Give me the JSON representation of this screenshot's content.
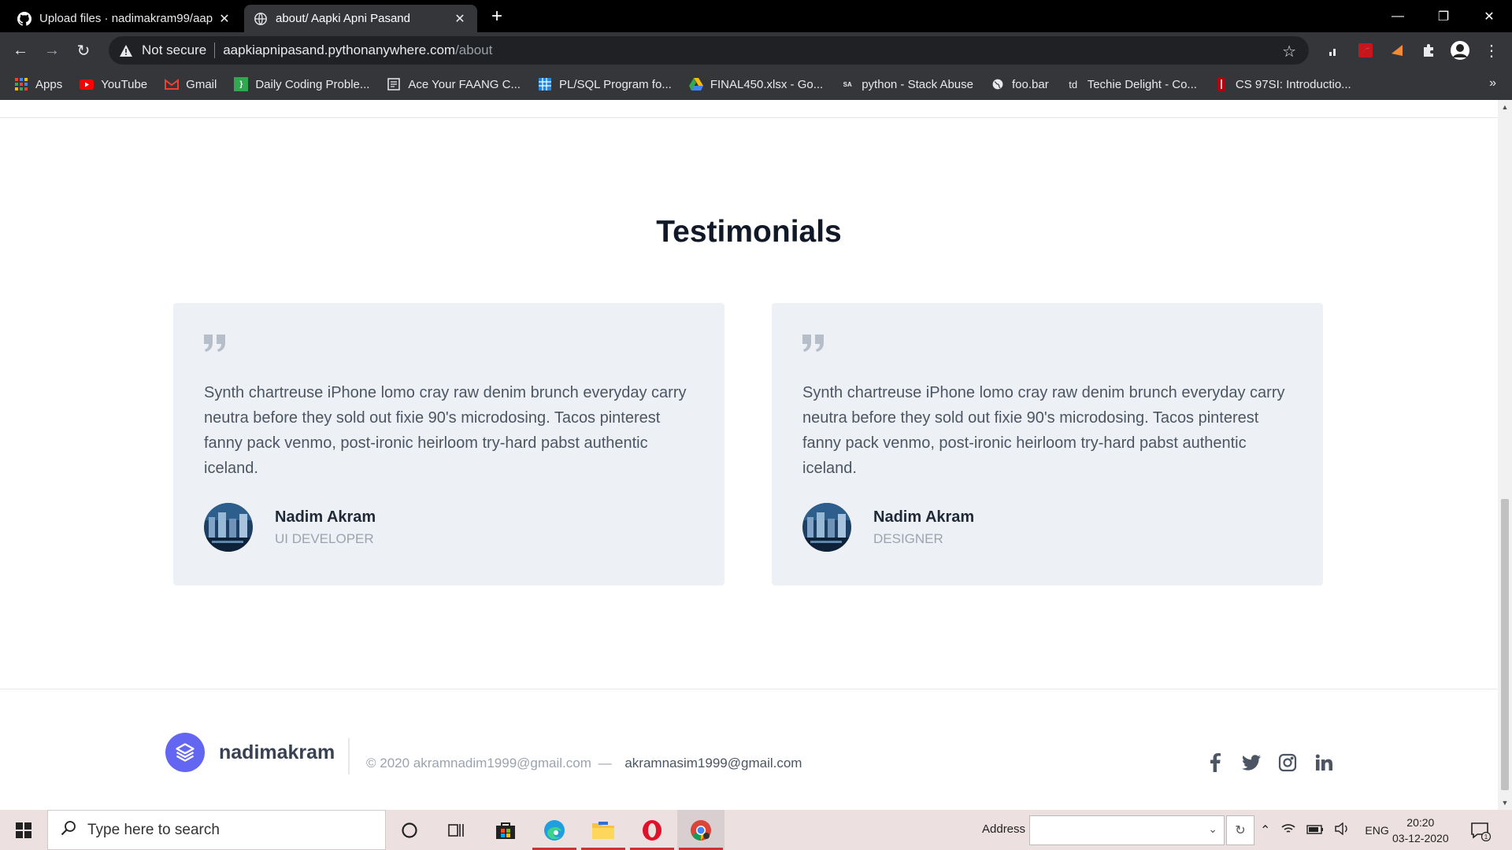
{
  "browser": {
    "tabs": [
      {
        "title": "Upload files · nadimakram99/aap",
        "active": false
      },
      {
        "title": "about/ Aapki Apni Pasand",
        "active": true
      }
    ],
    "not_secure_label": "Not secure",
    "url_host": "aapkiapnipasand.pythonanywhere.com",
    "url_path": "/about",
    "bookmarks": [
      {
        "label": "Apps",
        "icon": "apps-grid-icon"
      },
      {
        "label": "YouTube",
        "icon": "youtube-icon"
      },
      {
        "label": "Gmail",
        "icon": "gmail-icon"
      },
      {
        "label": "Daily Coding Proble...",
        "icon": "daily-coding-icon"
      },
      {
        "label": "Ace Your FAANG C...",
        "icon": "document-icon"
      },
      {
        "label": "PL/SQL Program fo...",
        "icon": "grid-icon"
      },
      {
        "label": "FINAL450.xlsx - Go...",
        "icon": "google-drive-icon"
      },
      {
        "label": "python - Stack Abuse",
        "icon": "stackabuse-icon"
      },
      {
        "label": "foo.bar",
        "icon": "globe-icon"
      },
      {
        "label": "Techie Delight - Co...",
        "icon": "td-icon"
      },
      {
        "label": "CS 97SI: Introductio...",
        "icon": "stanford-icon"
      }
    ]
  },
  "page": {
    "section_title": "Testimonials",
    "testimonials": [
      {
        "quote": "Synth chartreuse iPhone lomo cray raw denim brunch everyday carry neutra before they sold out fixie 90's microdosing. Tacos pinterest fanny pack venmo, post-ironic heirloom try-hard pabst authentic iceland.",
        "name": "Nadim Akram",
        "role": "UI DEVELOPER"
      },
      {
        "quote": "Synth chartreuse iPhone lomo cray raw denim brunch everyday carry neutra before they sold out fixie 90's microdosing. Tacos pinterest fanny pack venmo, post-ironic heirloom try-hard pabst authentic iceland.",
        "name": "Nadim Akram",
        "role": "DESIGNER"
      }
    ],
    "footer": {
      "brand": "nadimakram",
      "copyright": "© 2020 akramnadim1999@gmail.com",
      "dash": "—",
      "email2": "akramnasim1999@gmail.com",
      "social": [
        "facebook-icon",
        "twitter-icon",
        "instagram-icon",
        "linkedin-icon"
      ]
    },
    "colors": {
      "accent": "#6366f1",
      "card_bg": "#edf1f5"
    }
  },
  "taskbar": {
    "search_placeholder": "Type here to search",
    "address_label": "Address",
    "language": "ENG",
    "time": "20:20",
    "date": "03-12-2020",
    "notification_count": "1"
  }
}
